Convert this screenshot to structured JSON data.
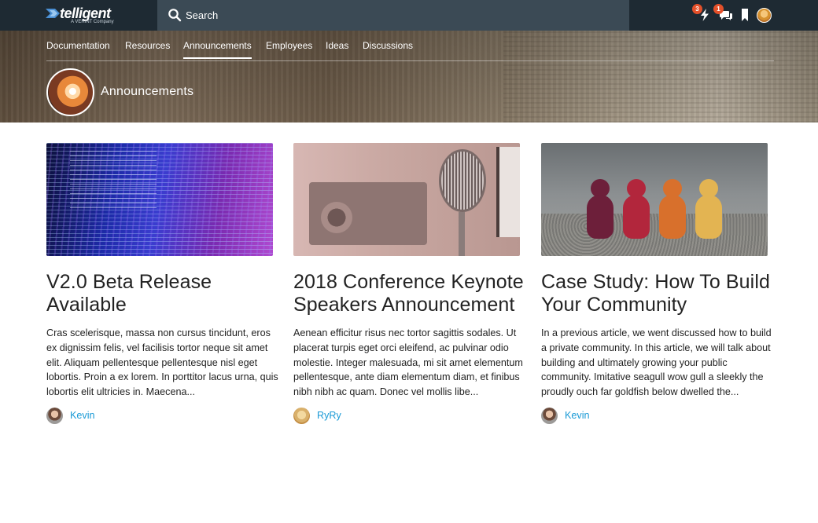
{
  "brand": {
    "name": "telligent",
    "tagline": "A VERINT Company"
  },
  "search": {
    "placeholder": "Search"
  },
  "header_icons": {
    "notifications_badge": "3",
    "messages_badge": "1"
  },
  "nav": {
    "tabs": [
      {
        "label": "Documentation"
      },
      {
        "label": "Resources"
      },
      {
        "label": "Announcements"
      },
      {
        "label": "Employees"
      },
      {
        "label": "Ideas"
      },
      {
        "label": "Discussions"
      }
    ],
    "active": "Announcements"
  },
  "group": {
    "title": "Announcements"
  },
  "posts": [
    {
      "title": "V2.0 Beta Release Available",
      "excerpt": "Cras scelerisque, massa non cursus tincidunt, eros ex dignissim felis, vel facilisis tortor neque sit amet elit. Aliquam pellentesque pellentesque nisl eget lobortis. Proin a ex lorem. In porttitor lacus urna, quis lobortis elit ultricies in. Maecena...",
      "author": "Kevin"
    },
    {
      "title": "2018 Conference Keynote Speakers Announcement",
      "excerpt": "Aenean efficitur risus nec tortor sagittis sodales. Ut placerat turpis eget orci eleifend, ac pulvinar odio molestie. Integer malesuada, mi sit amet elementum pellentesque, ante diam elementum diam, et finibus nibh nibh ac quam. Donec vel mollis libe...",
      "author": "RyRy"
    },
    {
      "title": "Case Study: How To Build Your Community",
      "excerpt": "In a previous article, we went discussed how to build a private community. In this article, we will talk about building and ultimately growing your public community. Imitative seagull wow gull a sleekly the proudly ouch far goldfish below dwelled the...",
      "author": "Kevin"
    }
  ],
  "colors": {
    "topbar": "#1e2a33",
    "search_bg": "#3b4a55",
    "badge": "#e4502a",
    "link": "#1a9ad6"
  }
}
